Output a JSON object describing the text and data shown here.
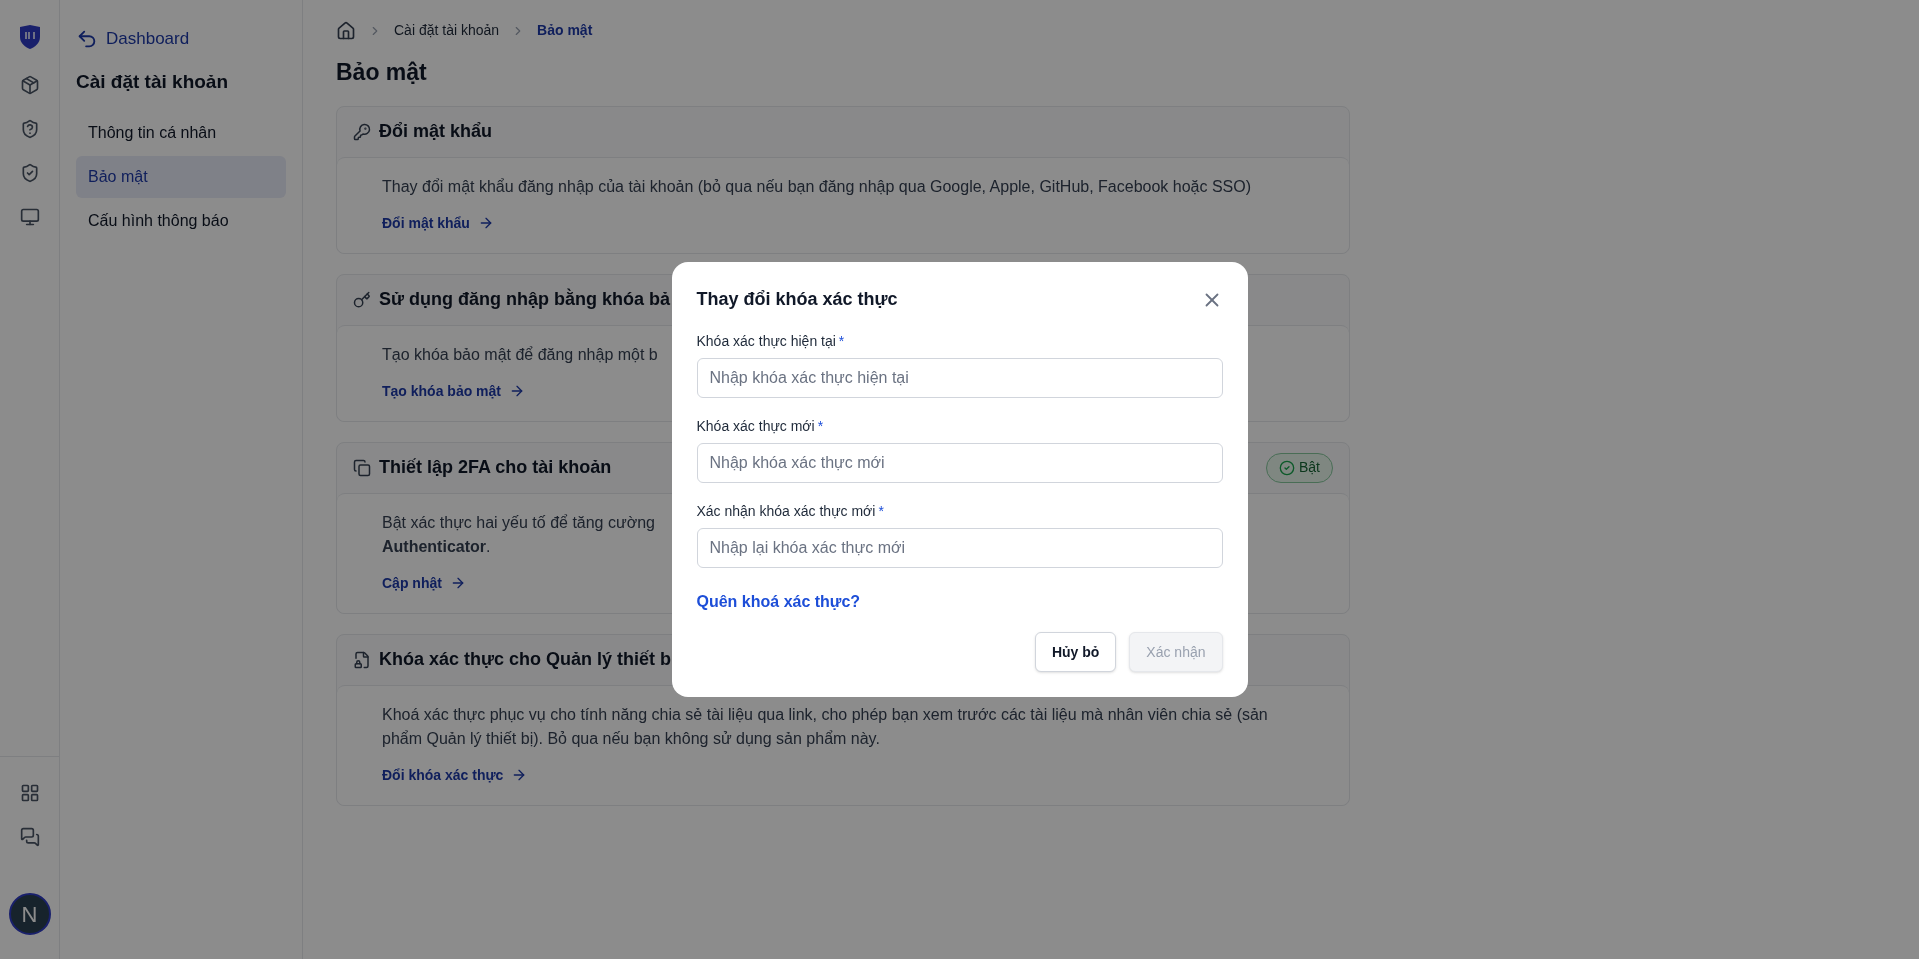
{
  "rail": {
    "avatar": "N"
  },
  "nav": {
    "back": "Dashboard",
    "title": "Cài đặt tài khoản",
    "items": [
      {
        "label": "Thông tin cá nhân",
        "selected": false
      },
      {
        "label": "Bảo mật",
        "selected": true
      },
      {
        "label": "Cấu hình thông báo",
        "selected": false
      }
    ]
  },
  "breadcrumb": [
    "Cài đặt tài khoản",
    "Bảo mật"
  ],
  "page_title": "Bảo mật",
  "cards": [
    {
      "kind": "password",
      "title": "Đổi mật khẩu",
      "description": [
        "Thay đổi mật khẩu đăng nhập của tài khoản (bỏ qua nếu bạn đăng nhập qua Google, Apple, GitHub, Facebook hoặc SSO)"
      ],
      "link": "Đổi mật khẩu"
    },
    {
      "kind": "key",
      "title": "Sử dụng đăng nhập bằng khóa bả",
      "description": [
        "Tạo khóa bảo mật để đăng nhập một b"
      ],
      "link": "Tạo khóa bảo mật"
    },
    {
      "kind": "twofa",
      "title": "Thiết lập 2FA cho tài khoản",
      "badge": {
        "label": "Bật"
      },
      "description": [
        "Bật xác thực hai yếu tố để tăng cường",
        "**Authenticator**."
      ],
      "link": "Cập nhật"
    },
    {
      "kind": "file",
      "title": "Khóa xác thực cho Quản lý thiết b",
      "description": [
        "Khoá xác thực phục vụ cho tính năng chia sẻ tài liệu qua link, cho phép bạn xem trước các tài liệu mà nhân viên chia sẻ (sản phẩm Quản lý thiết bị). Bỏ qua nếu bạn không sử dụng sản phẩm này."
      ],
      "link": "Đổi khóa xác thực"
    }
  ],
  "dialog": {
    "title": "Thay đổi khóa xác thực",
    "fields": [
      {
        "label": "Khóa xác thực hiện tại",
        "required_mark": "*",
        "placeholder": "Nhập khóa xác thực hiện tại"
      },
      {
        "label": "Khóa xác thực mới",
        "required_mark": "*",
        "placeholder": "Nhập khóa xác thực mới"
      },
      {
        "label": "Xác nhận khóa xác thực mới",
        "required_mark": "*",
        "placeholder": "Nhập lại khóa xác thực mới"
      }
    ],
    "link": "Quên khoá xác thực?",
    "buttons": [
      {
        "label": "Hủy bỏ",
        "disabled": false
      },
      {
        "label": "Xác nhận",
        "disabled": true
      }
    ]
  }
}
